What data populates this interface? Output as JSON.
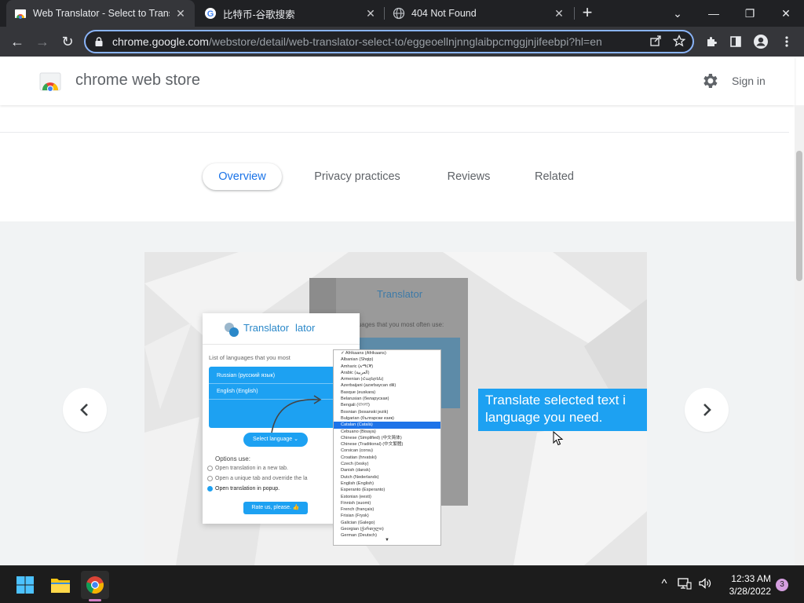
{
  "tabs": [
    {
      "title": "Web Translator - Select to Transla",
      "icon": "chrome-web-store-icon"
    },
    {
      "title": "比特币-谷歌搜索",
      "icon": "google-icon"
    },
    {
      "title": "404 Not Found",
      "icon": "globe-icon"
    }
  ],
  "tab_close_glyph": "✕",
  "new_tab_glyph": "+",
  "window_controls": {
    "tab_search": "⌄",
    "minimize": "—",
    "restore": "❐",
    "close": "✕"
  },
  "toolbar": {
    "back": "←",
    "forward": "→",
    "reload": "↻",
    "url_host": "chrome.google.com",
    "url_path": "/webstore/detail/web-translator-select-to/eggeoellnjnnglaibpcmggjnjifeebpi?hl=en"
  },
  "store": {
    "title": "chrome web store",
    "sign_in": "Sign in"
  },
  "nav_tabs": [
    "Overview",
    "Privacy practices",
    "Reviews",
    "Related"
  ],
  "gallery": {
    "prev": "‹",
    "next": "›",
    "callout_line1": "Translate selected text i",
    "callout_line2": "language you need.",
    "popup": {
      "logo": "Translator",
      "logo_overlap": "lator",
      "list_label": "List of languages that you most",
      "langs": [
        "Russian (русский язык)",
        "English (English)"
      ],
      "select_btn": "Select language ⌄",
      "options_title": "Options use:",
      "options": [
        "Open translation in a new tab.",
        "Open a unique tab and override the la",
        "Open translation in popup."
      ],
      "rate_btn": "Rate us, please. 👍"
    },
    "popup_bg": {
      "logo": "Translator",
      "text": "Languages that you most often use:",
      "op": "Op"
    },
    "dropdown": [
      "✓ Afrikaans (Afrikaans)",
      "Albanian (Shqip)",
      "Amharic (አማርኛ)",
      "Arabic (العربية)",
      "Armenian (Հայերեն)",
      "Azerbaijani (azərbaycan dili)",
      "Basque (euskara)",
      "Belarusian (беларуская)",
      "Bengali (বাংলা)",
      "Bosnian (bosanski jezik)",
      "Bulgarian (български език)",
      "Catalan (Català)",
      "Cebuano (Bisaya)",
      "Chinese (Simplified) (中文简体)",
      "Chinese (Traditional) (中文繁體)",
      "Corsican (corsu)",
      "Croatian (hrvatski)",
      "Czech (česky)",
      "Danish (dansk)",
      "Dutch (Nederlands)",
      "English (English)",
      "Esperanto (Esperanto)",
      "Estonian (eesti)",
      "Finnish (suomi)",
      "French (français)",
      "Frisian (Frysk)",
      "Galician (Galego)",
      "Georgian (ქართული)",
      "German (Deutsch)"
    ],
    "dropdown_highlight_index": 11
  },
  "taskbar": {
    "time": "12:33 AM",
    "date": "3/28/2022",
    "notifications": "3",
    "chevron": "^"
  },
  "colors": {
    "accent": "#1a73e8",
    "focus_ring": "#8ab4f8",
    "translator_blue": "#1da1f2"
  }
}
